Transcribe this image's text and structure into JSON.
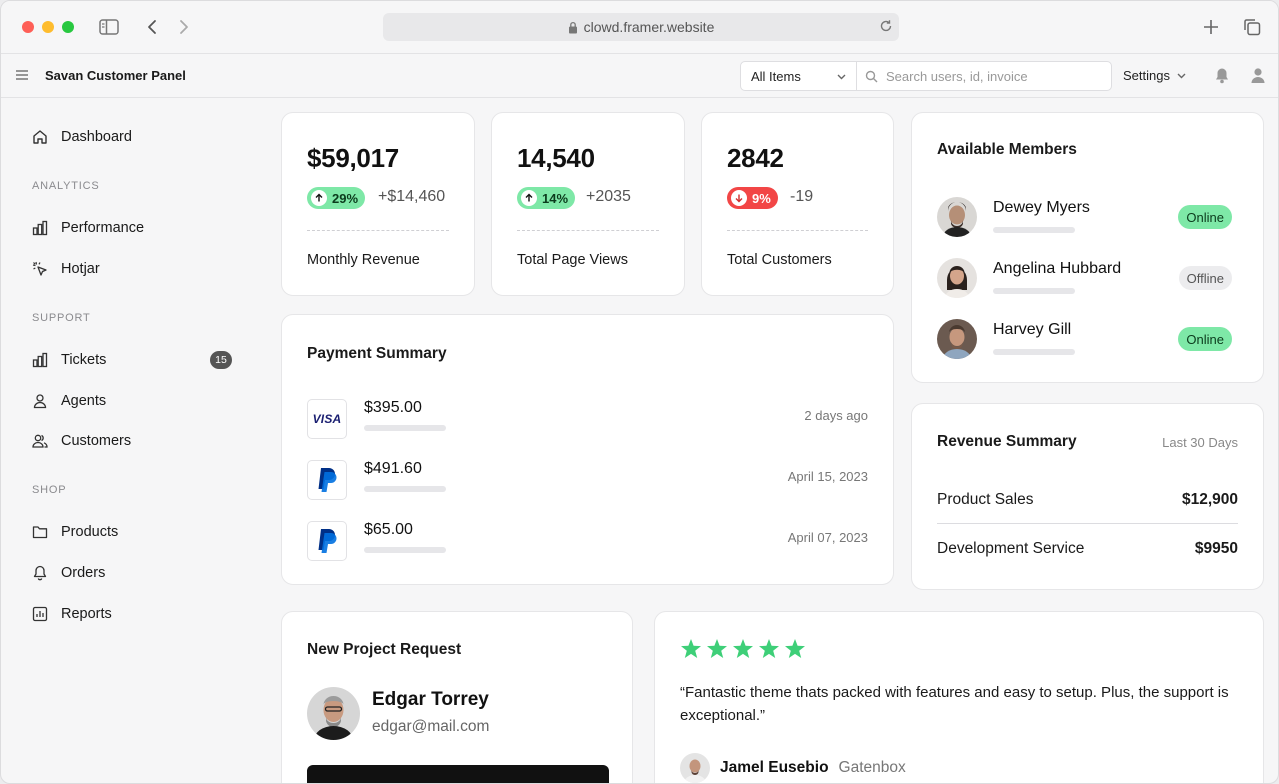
{
  "browser": {
    "url": "clowd.framer.website"
  },
  "topbar": {
    "app_title": "Savan Customer Panel",
    "filter_value": "All Items",
    "search_placeholder": "Search users, id, invoice",
    "settings_label": "Settings"
  },
  "sidebar": {
    "dashboard": "Dashboard",
    "analytics_label": "ANALYTICS",
    "performance": "Performance",
    "hotjar": "Hotjar",
    "support_label": "SUPPORT",
    "tickets": "Tickets",
    "tickets_count": "15",
    "agents": "Agents",
    "customers": "Customers",
    "shop_label": "SHOP",
    "products": "Products",
    "orders": "Orders",
    "reports": "Reports"
  },
  "stats": [
    {
      "value": "$59,017",
      "change": "29%",
      "direction": "up",
      "delta": "+$14,460",
      "label": "Monthly Revenue"
    },
    {
      "value": "14,540",
      "change": "14%",
      "direction": "up",
      "delta": "+2035",
      "label": "Total Page Views"
    },
    {
      "value": "2842",
      "change": "9%",
      "direction": "down",
      "delta": "-19",
      "label": "Total Customers"
    }
  ],
  "payment_summary": {
    "title": "Payment Summary",
    "rows": [
      {
        "method": "visa-icon",
        "amount": "$395.00",
        "date": "2 days ago"
      },
      {
        "method": "paypal-icon",
        "amount": "$491.60",
        "date": "April 15, 2023"
      },
      {
        "method": "paypal-icon",
        "amount": "$65.00",
        "date": "April 07, 2023"
      }
    ]
  },
  "members": {
    "title": "Available Members",
    "list": [
      {
        "name": "Dewey Myers",
        "status": "Online"
      },
      {
        "name": "Angelina Hubbard",
        "status": "Offline"
      },
      {
        "name": "Harvey Gill",
        "status": "Online"
      }
    ]
  },
  "revenue_summary": {
    "title": "Revenue Summary",
    "period": "Last 30 Days",
    "rows": [
      {
        "label": "Product Sales",
        "value": "$12,900"
      },
      {
        "label": "Development Service",
        "value": "$9950"
      }
    ]
  },
  "project_request": {
    "title": "New Project Request",
    "name": "Edgar Torrey",
    "email": "edgar@mail.com"
  },
  "testimonial": {
    "rating": 5,
    "quote": "“Fantastic theme thats packed with features and easy to setup. Plus, the support is exceptional.”",
    "author": "Jamel Eusebio",
    "company": "Gatenbox"
  },
  "colors": {
    "positive": "#7ee8a7",
    "negative": "#f24646",
    "star": "#3ecf78"
  }
}
